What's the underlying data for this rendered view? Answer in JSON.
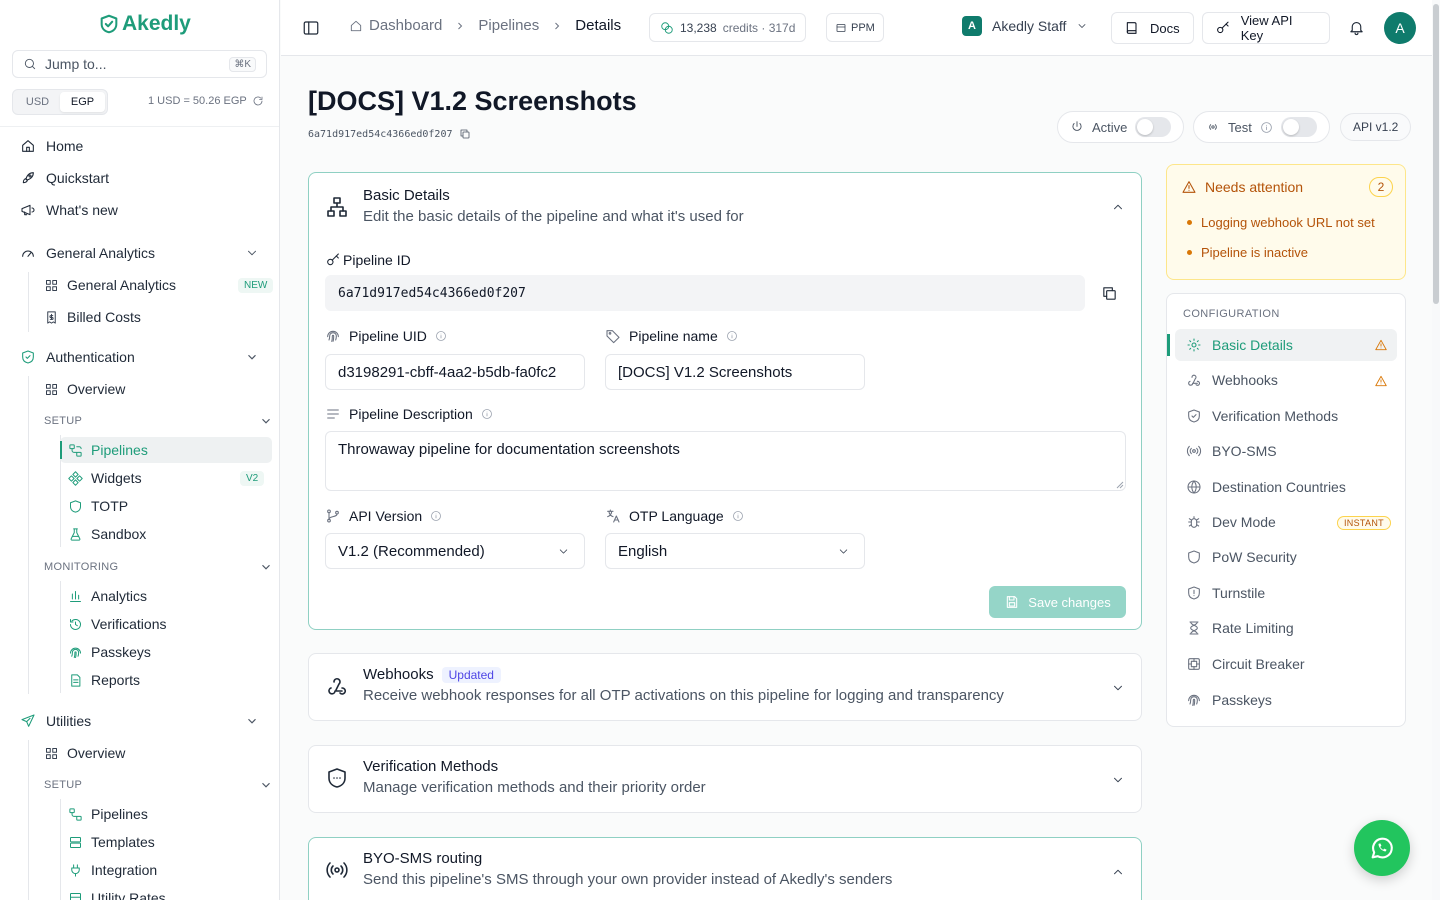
{
  "brand": {
    "name": "Akedly",
    "color": "#1e9c7a"
  },
  "sidebar": {
    "jump_placeholder": "Jump to...",
    "jump_shortcut": "⌘K",
    "currency": {
      "options": [
        "USD",
        "EGP"
      ],
      "selected": "EGP",
      "rate": "1 USD = 50.26 EGP"
    },
    "top_items": [
      {
        "label": "Home",
        "icon": "home-icon"
      },
      {
        "label": "Quickstart",
        "icon": "rocket-icon"
      },
      {
        "label": "What's new",
        "icon": "megaphone-icon"
      }
    ],
    "general_analytics": {
      "label": "General Analytics",
      "items": [
        {
          "label": "General Analytics",
          "badge": "NEW"
        },
        {
          "label": "Billed Costs"
        }
      ]
    },
    "authentication": {
      "label": "Authentication",
      "overview": "Overview",
      "setup_label": "SETUP",
      "setup_items": [
        {
          "label": "Pipelines"
        },
        {
          "label": "Widgets",
          "badge": "V2"
        },
        {
          "label": "TOTP"
        },
        {
          "label": "Sandbox"
        }
      ],
      "monitoring_label": "MONITORING",
      "monitoring_items": [
        {
          "label": "Analytics"
        },
        {
          "label": "Verifications"
        },
        {
          "label": "Passkeys"
        },
        {
          "label": "Reports"
        }
      ]
    },
    "utilities": {
      "label": "Utilities",
      "overview": "Overview",
      "setup_label": "SETUP",
      "setup_items": [
        {
          "label": "Pipelines"
        },
        {
          "label": "Templates"
        },
        {
          "label": "Integration"
        },
        {
          "label": "Utility Rates"
        }
      ]
    }
  },
  "topbar": {
    "breadcrumbs": [
      "Dashboard",
      "Pipelines",
      "Details"
    ],
    "credits": "13,238",
    "credits_suffix": "credits · 317d",
    "ppm": "PPM",
    "org": "Akedly Staff",
    "org_initial": "A",
    "docs": "Docs",
    "api_key": "View API Key",
    "avatar": "A"
  },
  "page": {
    "title": "[DOCS] V1.2 Screenshots",
    "id": "6a71d917ed54c4366ed0f207",
    "active_label": "Active",
    "test_label": "Test",
    "api_version_tag": "API v1.2"
  },
  "basic_details": {
    "title": "Basic Details",
    "subtitle": "Edit the basic details of the pipeline and what it's used for",
    "pipeline_id_label": "Pipeline ID",
    "pipeline_id": "6a71d917ed54c4366ed0f207",
    "uid_label": "Pipeline UID",
    "uid": "d3198291-cbff-4aa2-b5db-fa0fc2",
    "name_label": "Pipeline name",
    "name": "[DOCS] V1.2 Screenshots",
    "desc_label": "Pipeline Description",
    "desc": "Throwaway pipeline for documentation screenshots",
    "api_version_label": "API Version",
    "api_version": "V1.2 (Recommended)",
    "otp_lang_label": "OTP Language",
    "otp_lang": "English",
    "save": "Save changes"
  },
  "sections": [
    {
      "title": "Webhooks",
      "tag": "Updated",
      "subtitle": "Receive webhook responses for all OTP activations on this pipeline for logging and transparency"
    },
    {
      "title": "Verification Methods",
      "subtitle": "Manage verification methods and their priority order"
    },
    {
      "title": "BYO-SMS routing",
      "subtitle": "Send this pipeline's SMS through your own provider instead of Akedly's senders"
    }
  ],
  "attention": {
    "title": "Needs attention",
    "count": "2",
    "items": [
      "Logging webhook URL not set",
      "Pipeline is inactive"
    ]
  },
  "configuration": {
    "label": "CONFIGURATION",
    "items": [
      {
        "label": "Basic Details",
        "icon": "gear-icon",
        "warning": true,
        "active": true
      },
      {
        "label": "Webhooks",
        "icon": "webhook-icon",
        "warning": true
      },
      {
        "label": "Verification Methods",
        "icon": "shield-icon"
      },
      {
        "label": "BYO-SMS",
        "icon": "broadcast-icon"
      },
      {
        "label": "Destination Countries",
        "icon": "globe-icon"
      },
      {
        "label": "Dev Mode",
        "icon": "bug-icon",
        "badge": "INSTANT"
      },
      {
        "label": "PoW Security",
        "icon": "shield-icon"
      },
      {
        "label": "Turnstile",
        "icon": "shield-alert-icon"
      },
      {
        "label": "Rate Limiting",
        "icon": "hourglass-icon"
      },
      {
        "label": "Circuit Breaker",
        "icon": "circuit-icon"
      },
      {
        "label": "Passkeys",
        "icon": "fingerprint-icon"
      }
    ]
  }
}
